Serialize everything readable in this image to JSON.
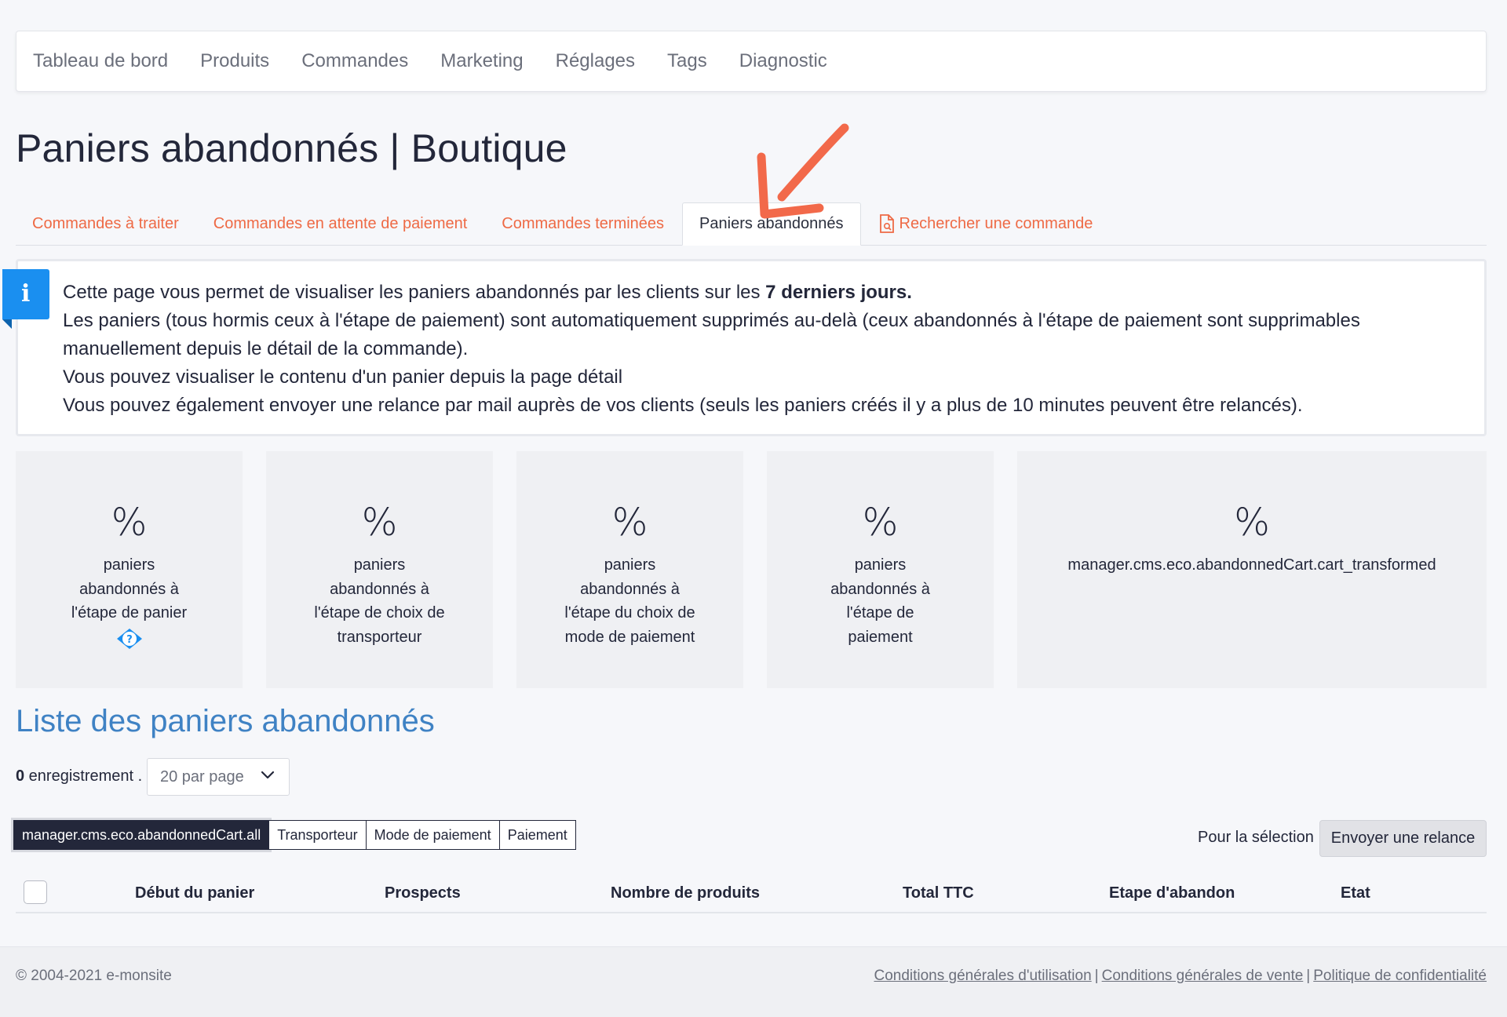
{
  "topnav": {
    "items": [
      "Tableau de bord",
      "Produits",
      "Commandes",
      "Marketing",
      "Réglages",
      "Tags",
      "Diagnostic"
    ]
  },
  "page": {
    "title": "Paniers abandonnés | Boutique"
  },
  "tabs": [
    {
      "label": "Commandes à traiter"
    },
    {
      "label": "Commandes en attente de paiement"
    },
    {
      "label": "Commandes terminées"
    },
    {
      "label": "Paniers abandonnés",
      "active": true
    },
    {
      "label": "Rechercher une commande"
    }
  ],
  "info": {
    "line1_prefix": "Cette page vous permet de visualiser les paniers abandonnés par les clients sur les ",
    "line1_bold": "7 derniers jours.",
    "line2": "Les paniers (tous hormis ceux à l'étape de paiement) sont automatiquement supprimés au-delà (ceux abandonnés à l'étape de paiement sont supprimables",
    "line3": "manuellement depuis le détail de la commande).",
    "line4": "Vous pouvez visualiser le contenu d'un panier depuis la page détail",
    "line5": "Vous pouvez également envoyer une relance par mail auprès de vos clients (seuls les paniers créés il y a plus de 10 minutes peuvent être relancés)."
  },
  "stats": [
    {
      "value": "%",
      "label_lines": [
        "paniers",
        "abandonnés à",
        "l'étape de panier"
      ]
    },
    {
      "value": "%",
      "label_lines": [
        "paniers",
        "abandonnés à",
        "l'étape de choix de",
        "transporteur"
      ]
    },
    {
      "value": "%",
      "label_lines": [
        "paniers",
        "abandonnés à",
        "l'étape du choix de",
        "mode de paiement"
      ]
    },
    {
      "value": "%",
      "label_lines": [
        "paniers",
        "abandonnés à",
        "l'étape de",
        "paiement"
      ]
    },
    {
      "value": "%",
      "label_lines": [
        "manager.cms.eco.abandonnedCart.cart_transformed"
      ]
    }
  ],
  "list": {
    "title": "Liste des paniers abandonnés",
    "count": "0",
    "count_suffix": " enregistrement .",
    "per_page": "20 par page"
  },
  "filters": [
    {
      "label": "manager.cms.eco.abandonnedCart.all",
      "active": true
    },
    {
      "label": "Transporteur"
    },
    {
      "label": "Mode de paiement"
    },
    {
      "label": "Paiement"
    }
  ],
  "selection": {
    "label": "Pour la sélection",
    "button": "Envoyer une relance"
  },
  "table": {
    "headers": [
      "Début du panier",
      "Prospects",
      "Nombre de produits",
      "Total TTC",
      "Etape d'abandon",
      "Etat"
    ]
  },
  "footer": {
    "copyright": "© 2004-2021 e-monsite",
    "links": [
      "Conditions générales d'utilisation",
      "Conditions générales de vente",
      "Politique de confidentialité"
    ],
    "separator": "|"
  },
  "colors": {
    "accent_orange": "#ee6a45",
    "info_blue": "#1a8ff0",
    "section_blue": "#3f82c4",
    "dark": "#23273a"
  }
}
